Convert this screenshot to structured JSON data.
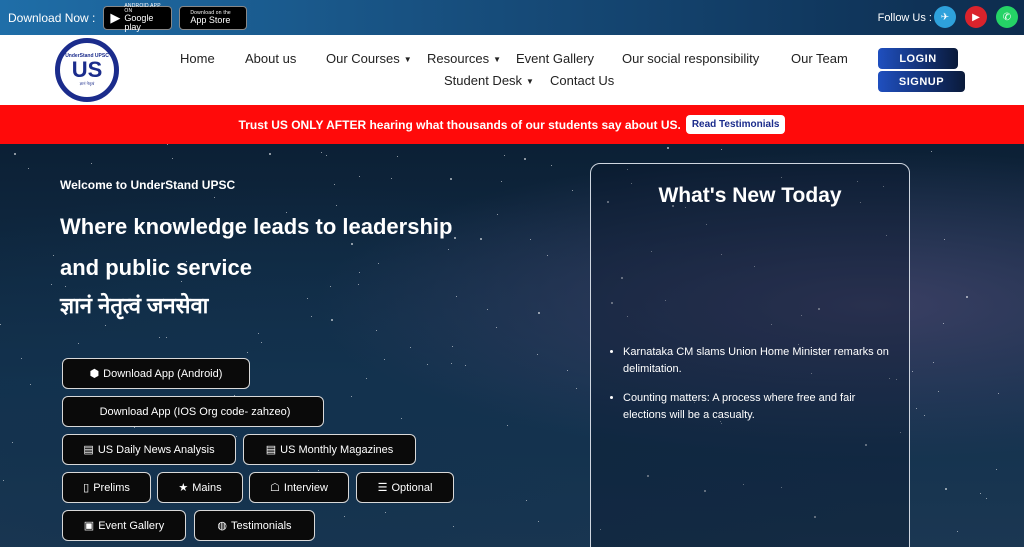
{
  "topbar": {
    "download_label": "Download Now :",
    "google_play": {
      "small": "ANDROID APP ON",
      "big": "Google play"
    },
    "app_store": {
      "small": "Download on the",
      "big": "App Store"
    },
    "follow_label": "Follow Us :",
    "social_icons": [
      "telegram-icon",
      "youtube-icon",
      "whatsapp-icon"
    ]
  },
  "header": {
    "logo": {
      "top": "UnderStand UPSC",
      "main": "US",
      "bottom": "ज्ञानं नेतृत्वं"
    },
    "nav": [
      {
        "label": "Home"
      },
      {
        "label": "About us"
      },
      {
        "label": "Our Courses"
      },
      {
        "label": "Resources"
      },
      {
        "label": "Event Gallery"
      },
      {
        "label": "Our social responsibility"
      },
      {
        "label": "Our Team"
      },
      {
        "label": "Student Desk"
      },
      {
        "label": "Contact Us"
      }
    ],
    "login_label": "LOGIN",
    "signup_label": "SIGNUP"
  },
  "banner": {
    "text": "Trust US ONLY AFTER hearing what thousands of our students say about US.",
    "button_label": "Read Testimonials",
    "color": "#ff0a0a"
  },
  "hero": {
    "welcome": "Welcome to UnderStand UPSC",
    "headline": "Where knowledge leads to leadership and public service",
    "hindi": "ज्ञानं नेतृत्वं जनसेवा",
    "buttons": [
      {
        "label": "Download App (Android)",
        "icon": "android-icon"
      },
      {
        "label": "Download App (IOS Org code- zahzeo)",
        "icon": "apple-icon"
      },
      {
        "label": "US Daily News Analysis",
        "icon": "newspaper-icon"
      },
      {
        "label": "US Monthly Magazines",
        "icon": "newspaper-icon"
      },
      {
        "label": "Prelims",
        "icon": "clipboard-icon"
      },
      {
        "label": "Mains",
        "icon": "star-icon"
      },
      {
        "label": "Interview",
        "icon": "interview-icon"
      },
      {
        "label": "Optional",
        "icon": "menu-icon"
      },
      {
        "label": "Event Gallery",
        "icon": "gallery-icon"
      },
      {
        "label": "Testimonials",
        "icon": "chat-icon"
      }
    ]
  },
  "whats_new": {
    "title": "What's New Today",
    "items": [
      "Karnataka CM slams Union Home Minister remarks on delimitation.",
      "Counting matters: A process where free and fair elections will be a casualty."
    ]
  }
}
